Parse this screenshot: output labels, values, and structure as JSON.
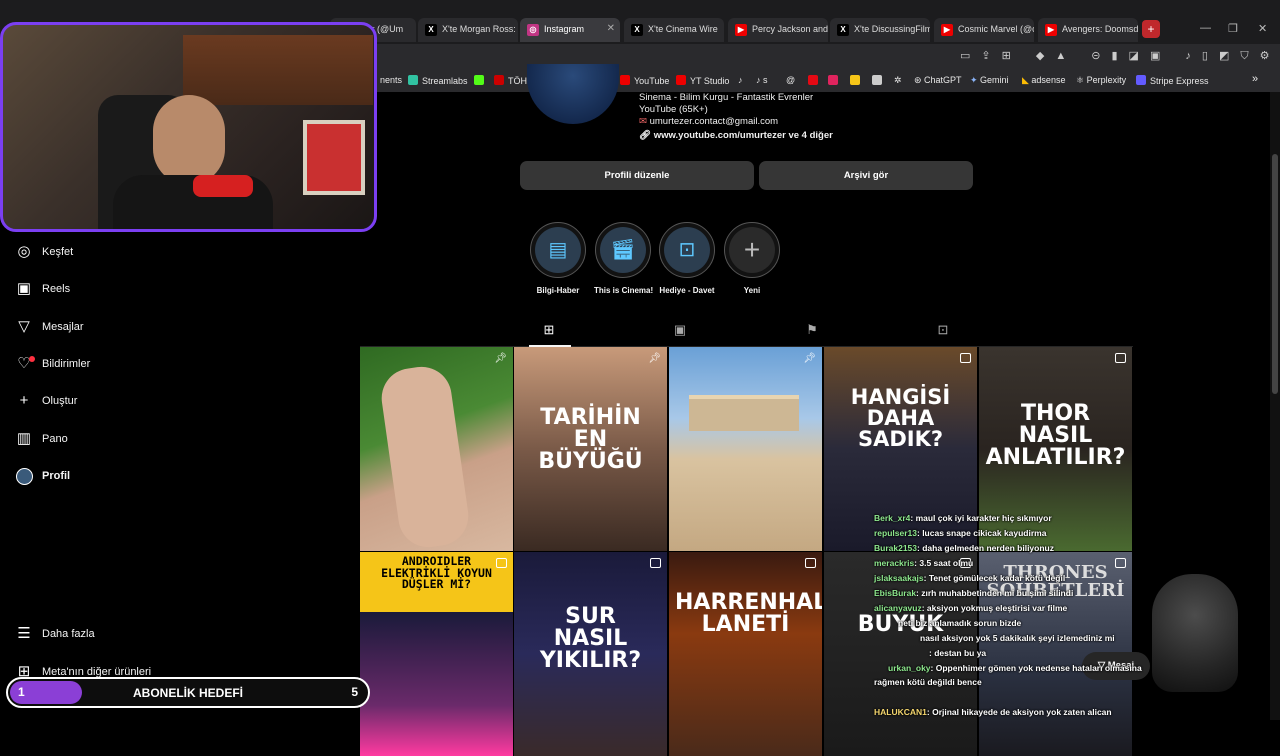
{
  "browser": {
    "tabs": [
      {
        "label": "rezer (@Um",
        "icon": "x",
        "color": "#c00"
      },
      {
        "label": "X'te Morgan Ross:",
        "icon": "x",
        "color": "#c00"
      },
      {
        "label": "Instagram",
        "icon": "instagram",
        "color": "#c13584",
        "active": true
      },
      {
        "label": "X'te Cinema Wire",
        "icon": "x",
        "color": "#c00"
      },
      {
        "label": "Percy Jackson and",
        "icon": "youtube",
        "color": "#c00"
      },
      {
        "label": "X'te DiscussingFilm",
        "icon": "x",
        "color": "#c00"
      },
      {
        "label": "Cosmic Marvel (@c",
        "icon": "youtube",
        "color": "#c00"
      },
      {
        "label": "Avengers: Doomsd",
        "icon": "youtube",
        "color": "#c00"
      }
    ],
    "bookmarks": [
      "nents",
      "Streamlabs",
      "",
      "TÖH",
      "",
      "",
      "",
      "",
      "YouTube",
      "YT Studio",
      "",
      "s",
      "",
      "",
      "",
      "",
      "",
      "ChatGPT",
      "Gemini",
      "adsense",
      "Perplexity",
      "Stripe Express"
    ],
    "more": "»"
  },
  "sidebar": {
    "items": [
      {
        "label": "Keşfet",
        "icon": "compass-icon"
      },
      {
        "label": "Reels",
        "icon": "reels-icon"
      },
      {
        "label": "Mesajlar",
        "icon": "send-icon"
      },
      {
        "label": "Bildirimler",
        "icon": "heart-icon"
      },
      {
        "label": "Oluştur",
        "icon": "plus-icon"
      },
      {
        "label": "Pano",
        "icon": "dashboard-icon"
      },
      {
        "label": "Profil",
        "icon": "avatar-icon"
      }
    ],
    "more": "Daha fazla",
    "meta": "Meta'nın diğer ürünleri"
  },
  "profile": {
    "bio": [
      "Sinema - Bilim Kurgu - Fantastik Evrenler",
      "YouTube (65K+)",
      "umurtezer.contact@gmail.com",
      "www.youtube.com/umurtezer ve 4 diğer"
    ],
    "edit_button": "Profili düzenle",
    "archive_button": "Arşivi gör",
    "highlights": [
      {
        "label": "Bilgi-Haber",
        "icon": "news-icon"
      },
      {
        "label": "This is Cinema!",
        "icon": "clapper-icon"
      },
      {
        "label": "Hediye - Davet",
        "icon": "gift-icon"
      },
      {
        "label": "Yeni",
        "icon": "plus-icon"
      }
    ]
  },
  "posts": [
    {
      "title": "",
      "kind": "pinned",
      "bg": "#3a6b2a"
    },
    {
      "title": "TARİHİN EN BÜYÜĞÜ",
      "kind": "pinned",
      "bg": "#6b4a3a"
    },
    {
      "title": "",
      "kind": "pinned",
      "bg": "#8fb5d9"
    },
    {
      "title": "HANGİSİ DAHA SADIK?",
      "kind": "reel",
      "bg": "#3b2a1a"
    },
    {
      "title": "THOR NASIL ANLATILIR?",
      "kind": "reel",
      "bg": "#2a2420"
    },
    {
      "title": "ANDROIDLER ELEKTRİKLİ KOYUN DÜŞLER Mİ?",
      "kind": "reel",
      "bg": "#1a1a2a"
    },
    {
      "title": "SUR NASIL YIKILIR?",
      "kind": "reel",
      "bg": "#1a1a3a"
    },
    {
      "title": "HARRENHAL LANETİ",
      "kind": "reel",
      "bg": "#3a1a10"
    },
    {
      "title": "BUYUK",
      "kind": "reel",
      "bg": "#2a2a2a"
    },
    {
      "title": "THRONES SOHBETLERİ",
      "kind": "reel",
      "bg": "#3a4050"
    }
  ],
  "stream": {
    "goal_label": "ABONELİK HEDEFİ",
    "goal_current": "1",
    "goal_target": "5",
    "message_button": "Mesaj",
    "chat": [
      {
        "user": "Berk_xr4",
        "text": ": maul çok iyi karakter hiç sıkmıyor"
      },
      {
        "user": "repulser13",
        "text": ": lucas snape cikicak kayudirma"
      },
      {
        "user": "Burak2153",
        "text": ": daha gelmeden nerden biliyonuz"
      },
      {
        "user": "merackris",
        "text": ": 3.5 saat olmu"
      },
      {
        "user": "jslaksaakajs",
        "text": ": Tenet gömülecek kadar kötü değil"
      },
      {
        "user": "EbisBurak",
        "text": ": zırh muhabbetinden mi bu şimi silindi"
      },
      {
        "user": "alicanyavuz",
        "text": ": aksiyon yokmuş eleştirisi var filme"
      },
      {
        "user": "",
        "text": "neti biz anlamadık sorun bizde"
      },
      {
        "user": "",
        "text": "nasıl aksiyon yok 5 dakikalık şeyi izlemediniz mi"
      },
      {
        "user": "",
        "text": ": destan bu ya"
      },
      {
        "user": "urkan_oky",
        "text": ": Oppenhimer gömen yok nedense hataları olmasına"
      },
      {
        "user": "",
        "text": "rağmen kötü değildi bence"
      },
      {
        "user": "",
        "text": ""
      },
      {
        "user": "HALUKCAN1",
        "text": ": Orjinal hikayede de aksiyon yok zaten alican"
      }
    ]
  }
}
